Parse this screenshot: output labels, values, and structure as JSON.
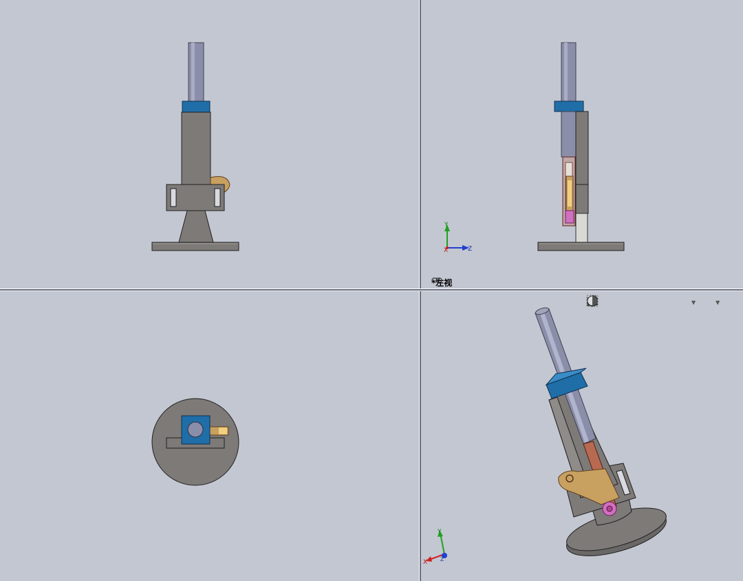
{
  "viewports": {
    "front": {
      "name": "front"
    },
    "left": {
      "name": "left",
      "label": "*左视"
    },
    "top": {
      "name": "top"
    },
    "iso": {
      "name": "iso"
    }
  },
  "triad": {
    "left_view": {
      "y": "Y",
      "x": "X",
      "z": "Z"
    },
    "iso_view": {
      "y": "Y",
      "x": "X",
      "z": "Z"
    }
  },
  "toolbar": {
    "items": [
      "zoom-to-fit-icon",
      "zoom-to-area-icon",
      "previous-view-icon",
      "section-view-icon",
      "view-orientation-icon",
      "display-style-icon",
      "hide-show-items-icon",
      "edit-appearance-icon"
    ]
  },
  "colors": {
    "background": "#c3c7d1",
    "body": "#7d7a78",
    "cylinder": "#8a8ea8",
    "collar": "#1f6ea8",
    "bronze": "#c8a060",
    "rod": "#b86a50",
    "pink": "#d070c0"
  }
}
